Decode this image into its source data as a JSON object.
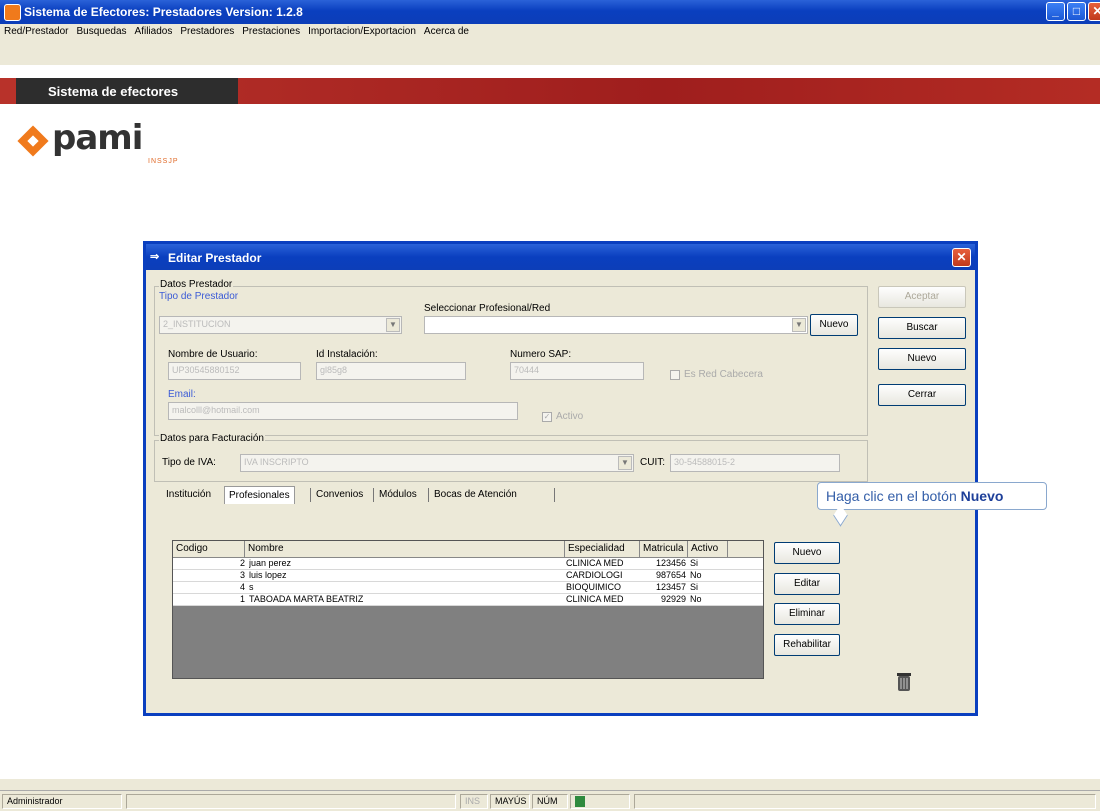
{
  "window": {
    "title": "Sistema de Efectores: Prestadores Version: 1.2.8"
  },
  "menu": [
    "Red/Prestador",
    "Busquedas",
    "Afiliados",
    "Prestadores",
    "Prestaciones",
    "Importacion/Exportacion",
    "Acerca de"
  ],
  "banner": {
    "title": "Sistema de efectores"
  },
  "logo": {
    "text": "pami",
    "sub": "INSSJP"
  },
  "dialog": {
    "title": "Editar Prestador",
    "datos_prestador": {
      "group_label": "Datos Prestador",
      "tipo_label": "Tipo de Prestador",
      "tipo_value": "2_INSTITUCION",
      "seleccionar_label": "Seleccionar Profesional/Red",
      "seleccionar_value": "",
      "nuevo_label": "Nuevo",
      "usuario_label": "Nombre de Usuario:",
      "usuario_value": "UP30545880152",
      "instalacion_label": "Id Instalación:",
      "instalacion_value": "gl85g8",
      "sap_label": "Numero SAP:",
      "sap_value": "70444",
      "esred_label": "Es Red Cabecera",
      "email_label": "Email:",
      "email_value": "malcolll@hotmail.com",
      "activo_label": "Activo"
    },
    "facturacion": {
      "group_label": "Datos para Facturación",
      "iva_label": "Tipo de IVA:",
      "iva_value": "IVA INSCRIPTO",
      "cuit_label": "CUIT:",
      "cuit_value": "30-54588015-2"
    },
    "side_buttons": {
      "aceptar": "Aceptar",
      "buscar": "Buscar",
      "nuevo": "Nuevo",
      "cerrar": "Cerrar"
    },
    "tabs": [
      "Institución",
      "Profesionales",
      "Convenios",
      "Módulos",
      "Bocas de Atención"
    ],
    "grid": {
      "columns": [
        "Codigo",
        "Nombre",
        "Especialidad",
        "Matricula",
        "Activo"
      ],
      "rows": [
        {
          "codigo": "2",
          "nombre": "juan perez",
          "especialidad": "CLINICA MED",
          "matricula": "123456",
          "activo": "Si"
        },
        {
          "codigo": "3",
          "nombre": "luis lopez",
          "especialidad": "CARDIOLOGI",
          "matricula": "987654",
          "activo": "No"
        },
        {
          "codigo": "4",
          "nombre": "s",
          "especialidad": "BIOQUIMICO",
          "matricula": "123457",
          "activo": "Si"
        },
        {
          "codigo": "1",
          "nombre": "TABOADA MARTA BEATRIZ",
          "especialidad": "CLINICA MED",
          "matricula": "92929",
          "activo": "No"
        }
      ]
    },
    "grid_buttons": {
      "nuevo": "Nuevo",
      "editar": "Editar",
      "eliminar": "Eliminar",
      "rehabilitar": "Rehabilitar"
    }
  },
  "callout": {
    "text": "Haga clic en el botón ",
    "bold": "Nuevo"
  },
  "statusbar": {
    "user": "Administrador",
    "ins": "INS",
    "mayus": "MAYÚS",
    "num": "NÚM"
  }
}
